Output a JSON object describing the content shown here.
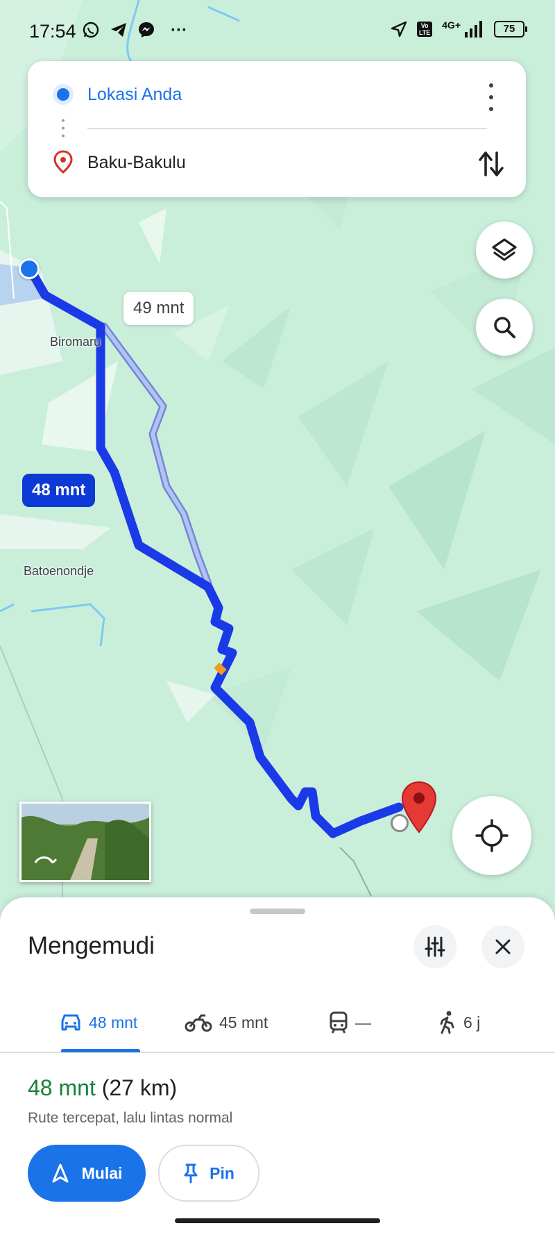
{
  "status_bar": {
    "time": "17:54",
    "network": "4G+",
    "volte": "Vo LTE",
    "battery": "75",
    "more": "···"
  },
  "directions": {
    "origin": "Lokasi Anda",
    "destination": "Baku-Bakulu"
  },
  "map": {
    "place_labels": [
      "Biromaru",
      "Batoenondje"
    ],
    "alt_route_time": "49 mnt",
    "main_route_time": "48 mnt",
    "colors": {
      "route": "#1a3ae8",
      "alt_route": "#a9b8f0",
      "map_bg": "#c9efdb",
      "dest_pin": "#e53935"
    }
  },
  "sheet": {
    "title": "Mengemudi",
    "modes": [
      {
        "icon": "car-icon",
        "label": "48 mnt"
      },
      {
        "icon": "motorcycle-icon",
        "label": "45 mnt"
      },
      {
        "icon": "transit-icon",
        "label": "—"
      },
      {
        "icon": "walk-icon",
        "label": "6 j"
      }
    ],
    "route_time": "48 mnt",
    "route_distance": "(27 km)",
    "route_desc": "Rute tercepat, lalu lintas normal",
    "start_label": "Mulai",
    "pin_label": "Pin",
    "accent": "#1a73e8",
    "time_color": "#188038"
  }
}
